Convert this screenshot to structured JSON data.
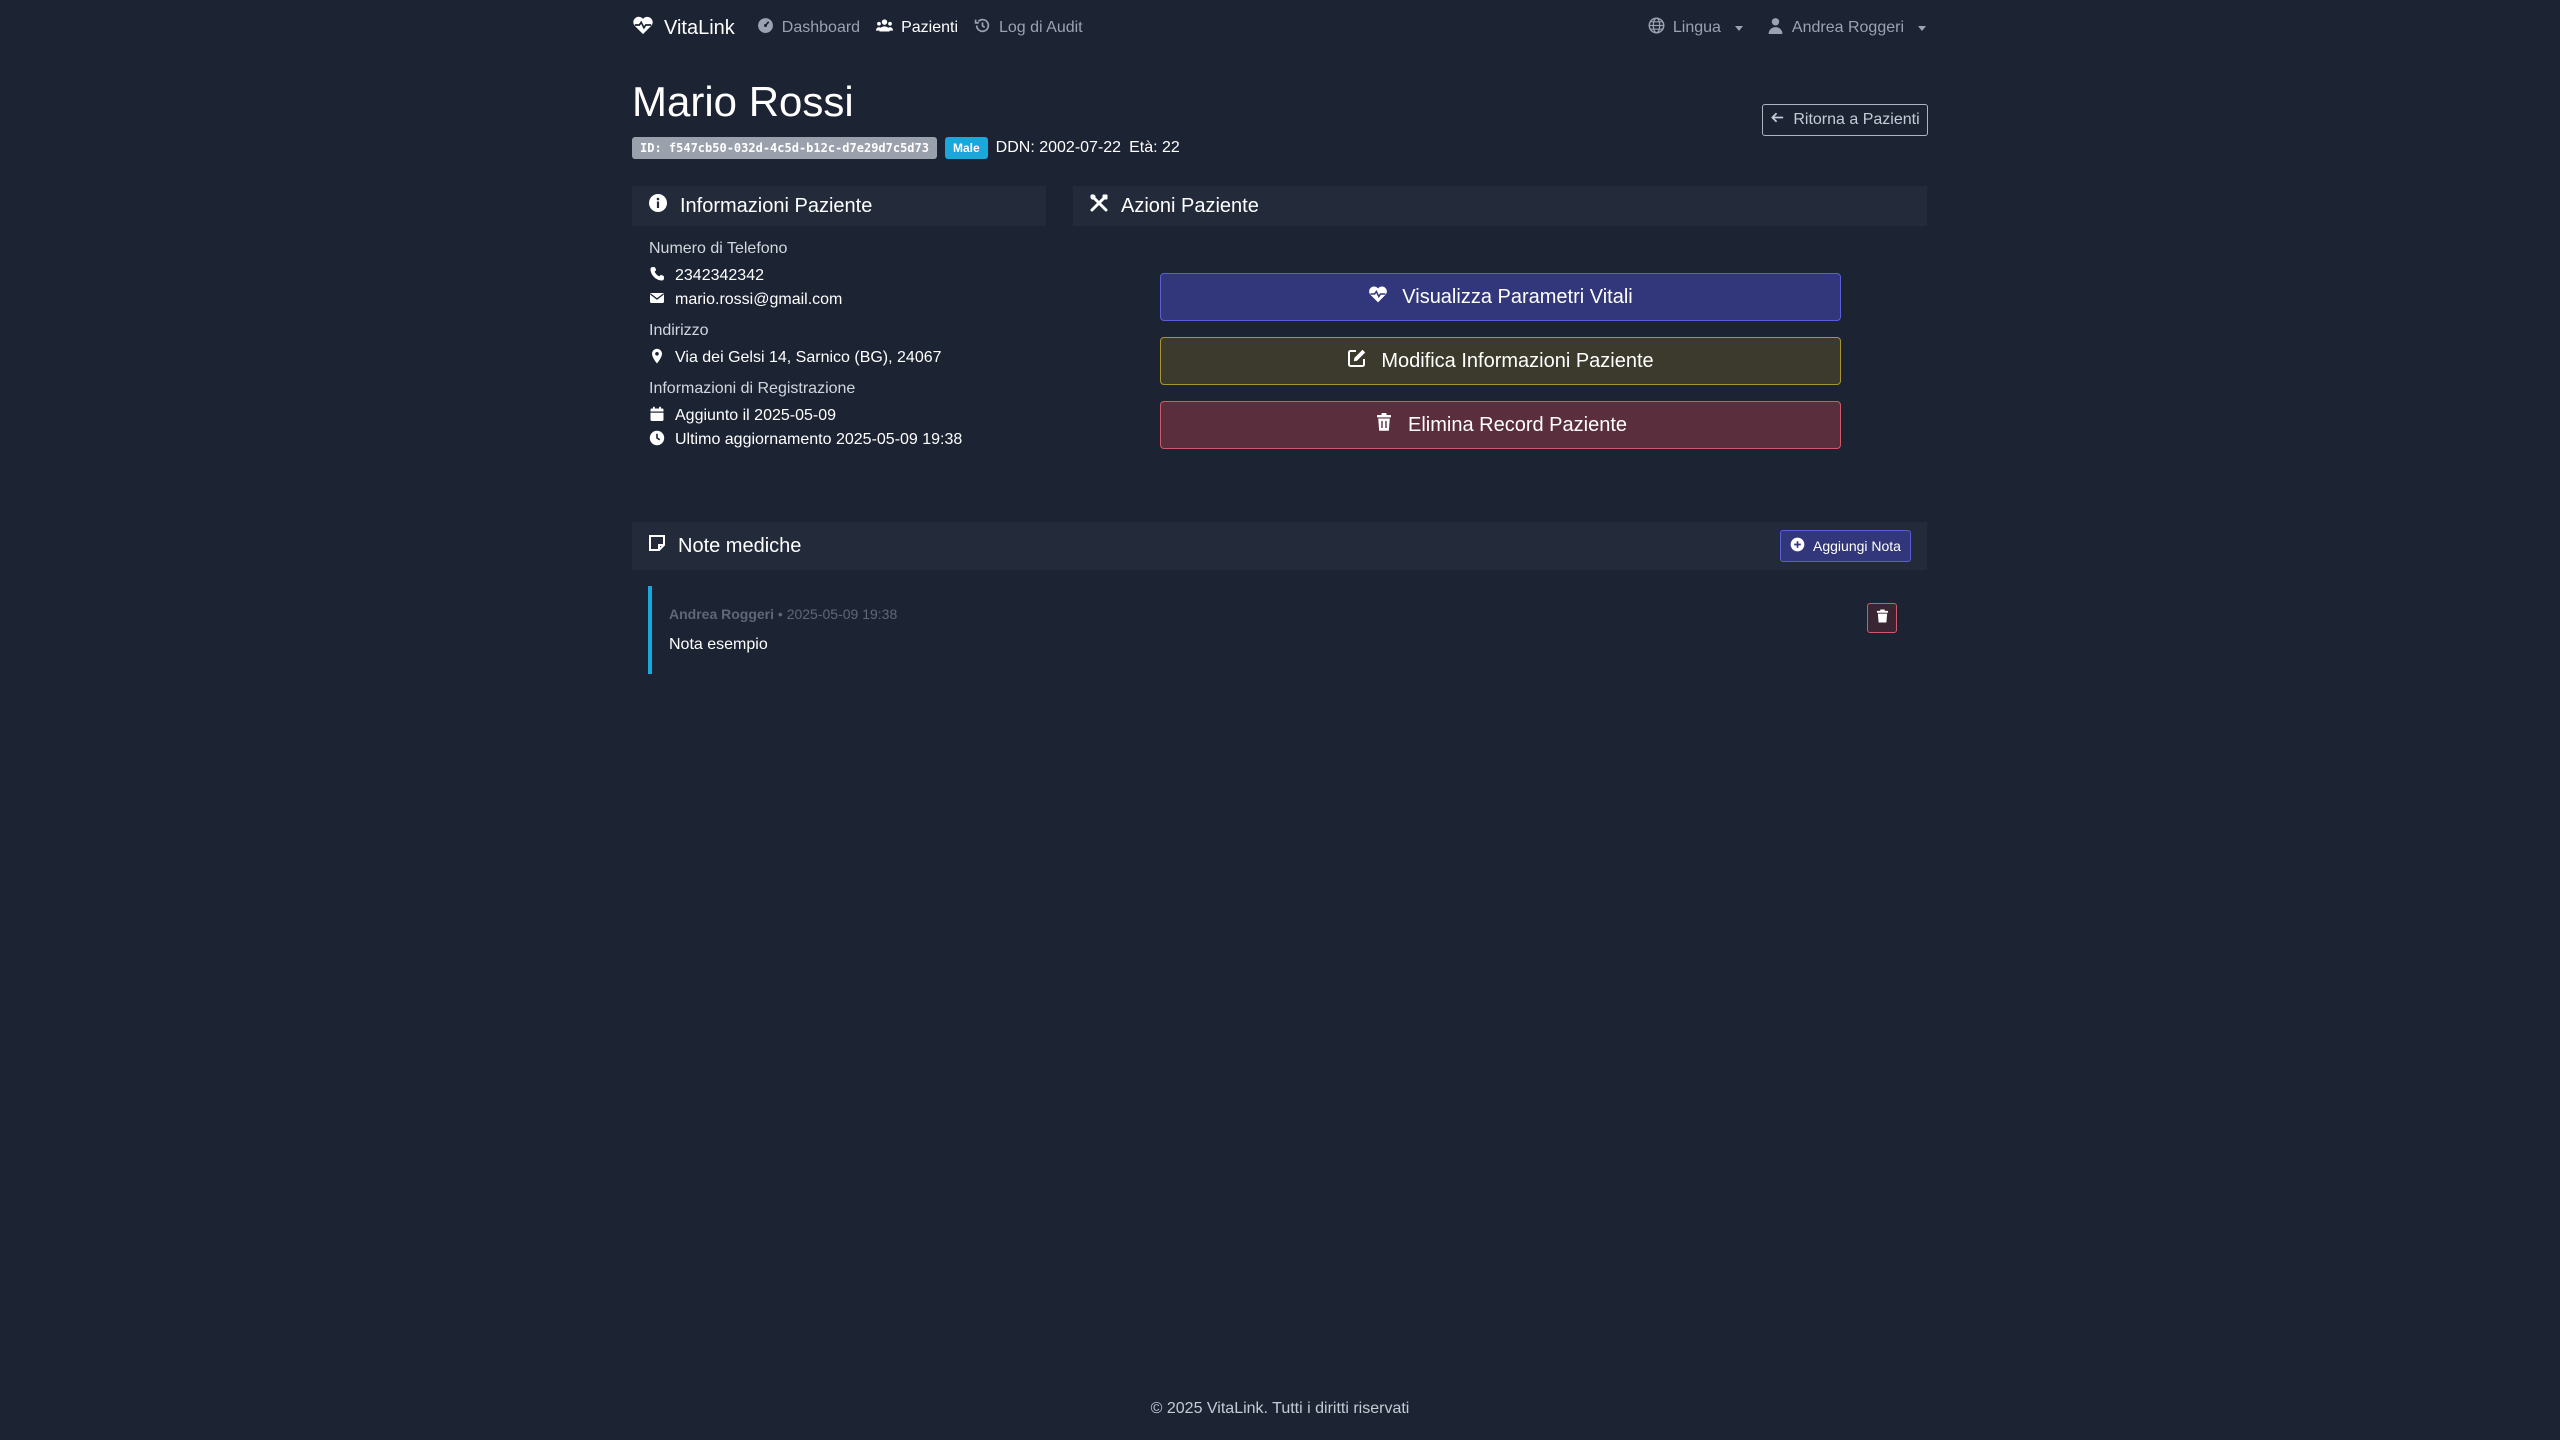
{
  "nav": {
    "brand": "VitaLink",
    "links": [
      {
        "label": "Dashboard",
        "icon": "dashboard-gauge-icon"
      },
      {
        "label": "Pazienti",
        "icon": "users-icon"
      },
      {
        "label": "Log di Audit",
        "icon": "history-icon"
      }
    ],
    "language_label": "Lingua",
    "user_label": "Andrea Roggeri"
  },
  "patient": {
    "name": "Mario Rossi",
    "id_badge": "ID: f547cb50-032d-4c5d-b12c-d7e29d7c5d73",
    "gender_badge": "Male",
    "dob": "DDN: 2002-07-22",
    "age": "Età: 22"
  },
  "back_button": "Ritorna a Pazienti",
  "info_card": {
    "title": "Informazioni Paziente",
    "phone_label": "Numero di Telefono",
    "phone": "2342342342",
    "email": "mario.rossi@gmail.com",
    "address_label": "Indirizzo",
    "address": "Via dei Gelsi 14, Sarnico (BG), 24067",
    "registration_label": "Informazioni di Registrazione",
    "added": "Aggiunto il 2025-05-09",
    "updated": "Ultimo aggiornamento 2025-05-09 19:38"
  },
  "actions_card": {
    "title": "Azioni Paziente",
    "view_vitals": "Visualizza Parametri Vitali",
    "edit_info": "Modifica Informazioni Paziente",
    "delete_record": "Elimina Record Paziente"
  },
  "notes": {
    "title": "Note mediche",
    "add_button": "Aggiungi Nota",
    "items": [
      {
        "author": "Andrea Roggeri",
        "separator": " • ",
        "timestamp": "2025-05-09 19:38",
        "text": "Nota esempio"
      }
    ]
  },
  "footer": "© 2025 VitaLink. Tutti i diritti riservati",
  "colors": {
    "background": "#1c2333",
    "card_header": "#232b3b",
    "primary": "#5a5fd6",
    "warning": "#a89532",
    "danger": "#d05a6a",
    "info": "#1aa7d9"
  }
}
